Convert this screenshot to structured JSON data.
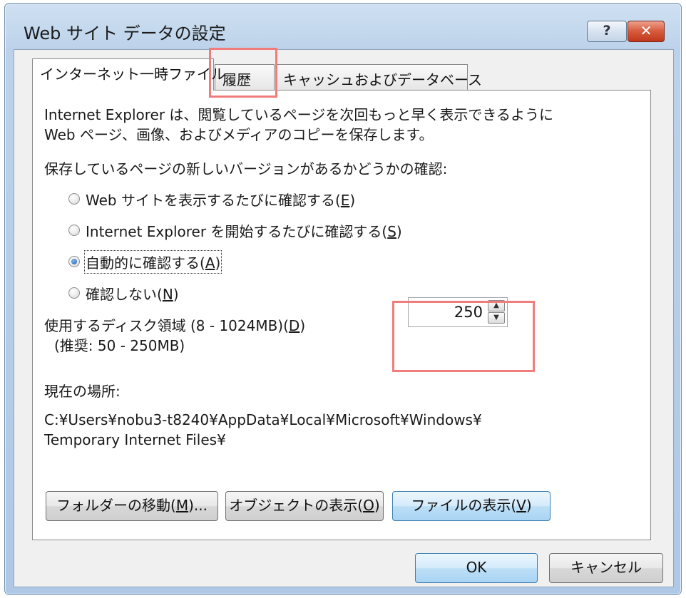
{
  "window": {
    "title": "Web サイト データの設定",
    "help_label": "?",
    "close_label": "✕"
  },
  "tabs": [
    {
      "label": "インターネット一時ファイル",
      "active": true
    },
    {
      "label": "履歴",
      "active": false,
      "highlighted": true
    },
    {
      "label": "キャッシュおよびデータベース",
      "active": false
    }
  ],
  "panel": {
    "description_line1": "Internet Explorer は、閲覧しているページを次回もっと早く表示できるように",
    "description_line2": "Web ページ、画像、およびメディアのコピーを保存します。",
    "check_heading": "保存しているページの新しいバージョンがあるかどうかの確認:",
    "radio_options": [
      {
        "label": "Web サイトを表示するたびに確認する(",
        "mnemonic": "E",
        "suffix": ")",
        "checked": false
      },
      {
        "label": "Internet Explorer を開始するたびに確認する(",
        "mnemonic": "S",
        "suffix": ")",
        "checked": false
      },
      {
        "label": "自動的に確認する(",
        "mnemonic": "A",
        "suffix": ")",
        "checked": true
      },
      {
        "label": "確認しない(",
        "mnemonic": "N",
        "suffix": ")",
        "checked": false
      }
    ],
    "disk_label_prefix": "使用するディスク領域 (8 - 1024MB)(",
    "disk_label_mnemonic": "D",
    "disk_label_suffix": ")",
    "disk_recommend": "(推奨: 50 - 250MB)",
    "disk_value": "250",
    "location_heading": "現在の場所:",
    "location_line1": "C:¥Users¥nobu3-t8240¥AppData¥Local¥Microsoft¥Windows¥",
    "location_line2": "Temporary Internet Files¥"
  },
  "buttons": {
    "move_folder": {
      "prefix": "フォルダーの移動(",
      "mnemonic": "M",
      "suffix": ")..."
    },
    "view_objects": {
      "prefix": "オブジェクトの表示(",
      "mnemonic": "O",
      "suffix": ")"
    },
    "view_files": {
      "prefix": "ファイルの表示(",
      "mnemonic": "V",
      "suffix": ")"
    },
    "ok": "OK",
    "cancel": "キャンセル"
  },
  "colors": {
    "highlight": "#f07c7c",
    "default_button": "#3c7fb1"
  }
}
